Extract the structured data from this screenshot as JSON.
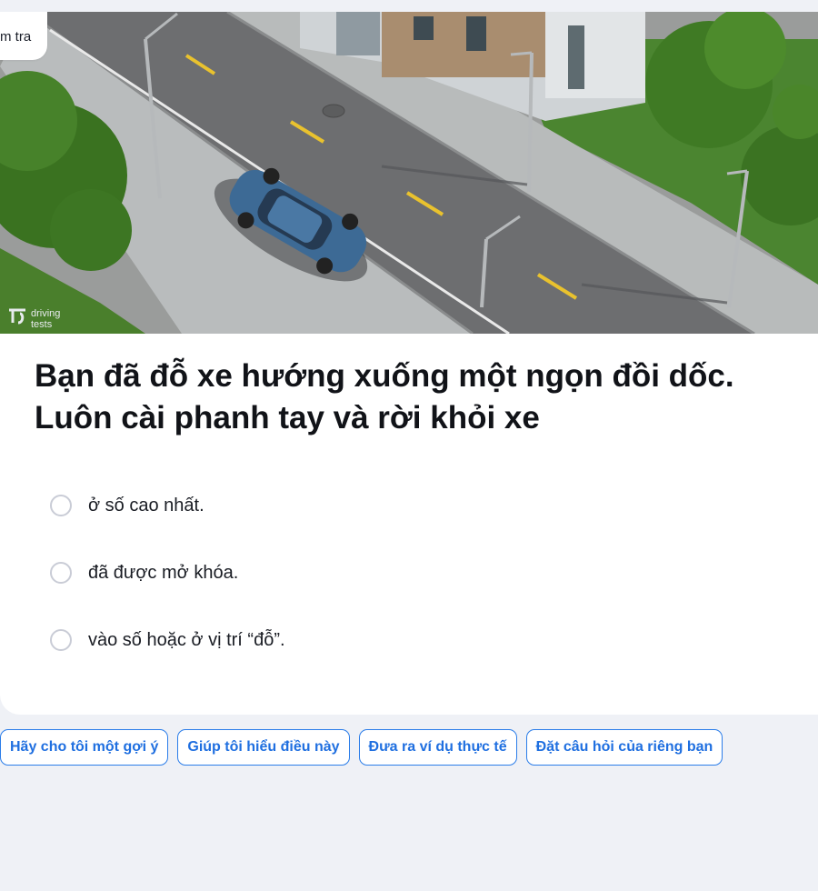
{
  "tab": {
    "label": "m tra"
  },
  "image": {
    "watermark_line1": "driving",
    "watermark_line2": "tests"
  },
  "question": {
    "line1": "Bạn đã đỗ xe hướng xuống một ngọn đồi dốc.",
    "line2": "Luôn cài phanh tay và rời khỏi xe"
  },
  "options": [
    {
      "label": "ở số cao nhất."
    },
    {
      "label": "đã được mở khóa."
    },
    {
      "label": "vào số hoặc ở vị trí “đỗ”."
    }
  ],
  "helpers": [
    {
      "label": "Hãy cho tôi một gợi ý"
    },
    {
      "label": "Giúp tôi hiểu điều này"
    },
    {
      "label": "Đưa ra ví dụ thực tế"
    },
    {
      "label": "Đặt câu hỏi của riêng bạn"
    }
  ],
  "colors": {
    "accent": "#2b7de9",
    "page_bg": "#eff1f6",
    "car": "#3d6a95",
    "road": "#6e6f70",
    "grass": "#4f8a2e"
  }
}
